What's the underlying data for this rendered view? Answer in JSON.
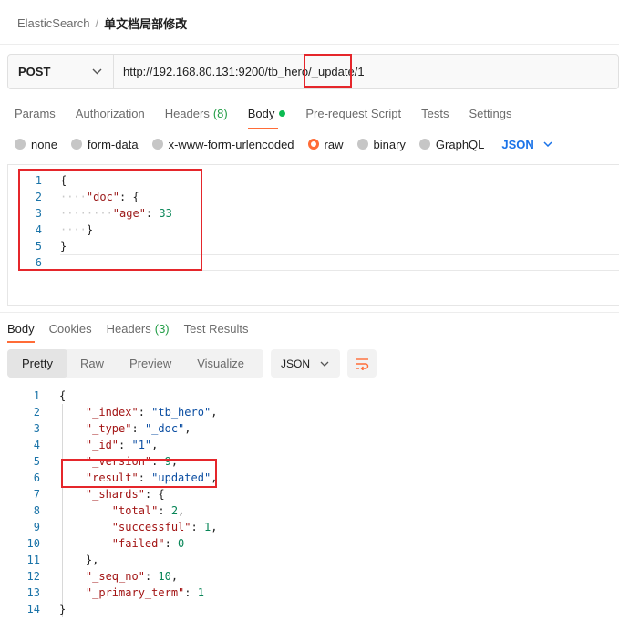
{
  "breadcrumb": {
    "parent": "ElasticSearch",
    "separator": "/",
    "current": "单文档局部修改"
  },
  "request": {
    "method": "POST",
    "url": "http://192.168.80.131:9200/tb_hero/_update/1"
  },
  "request_tabs": [
    {
      "label": "Params"
    },
    {
      "label": "Authorization"
    },
    {
      "label": "Headers",
      "count": "(8)"
    },
    {
      "label": "Body",
      "active": true
    },
    {
      "label": "Pre-request Script"
    },
    {
      "label": "Tests"
    },
    {
      "label": "Settings"
    }
  ],
  "body_types": [
    "none",
    "form-data",
    "x-www-form-urlencoded",
    "raw",
    "binary",
    "GraphQL"
  ],
  "selected_body_type": "raw",
  "body_format": "JSON",
  "request_body": {
    "line_numbers": [
      "1",
      "2",
      "3",
      "4",
      "5",
      "6"
    ],
    "lines": [
      "{",
      "    \"doc\": {",
      "        \"age\": 33",
      "    }",
      "}",
      ""
    ]
  },
  "response_tabs": [
    {
      "label": "Body",
      "active": true
    },
    {
      "label": "Cookies"
    },
    {
      "label": "Headers",
      "count": "(3)"
    },
    {
      "label": "Test Results"
    }
  ],
  "view_modes": [
    "Pretty",
    "Raw",
    "Preview",
    "Visualize"
  ],
  "response_format": "JSON",
  "response_body": {
    "line_numbers": [
      "1",
      "2",
      "3",
      "4",
      "5",
      "6",
      "7",
      "8",
      "9",
      "10",
      "11",
      "12",
      "13",
      "14"
    ],
    "lines": [
      "{",
      "    \"_index\": \"tb_hero\",",
      "    \"_type\": \"_doc\",",
      "    \"_id\": \"1\",",
      "    \"_version\": 9,",
      "    \"result\": \"updated\",",
      "    \"_shards\": {",
      "        \"total\": 2,",
      "        \"successful\": 1,",
      "        \"failed\": 0",
      "    },",
      "    \"_seq_no\": 10,",
      "    \"_primary_term\": 1",
      "}"
    ]
  },
  "colors": {
    "accent": "#ff6c37",
    "annotation": "#e5262b",
    "link_blue": "#1a73e8"
  }
}
